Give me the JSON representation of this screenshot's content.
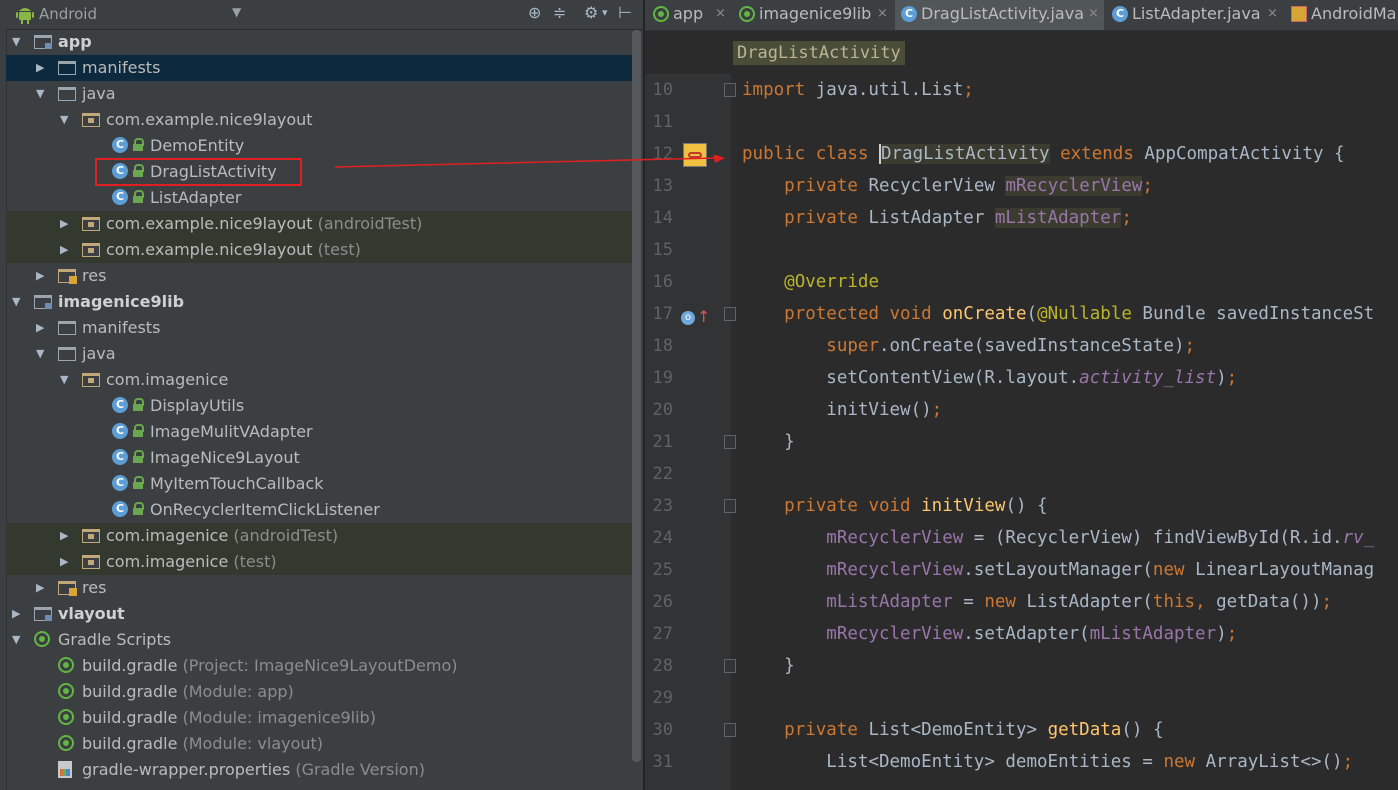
{
  "project_panel": {
    "view_selector": "Android",
    "tools": [
      "target-icon",
      "collapse-icon",
      "settings-icon",
      "pin-icon"
    ],
    "tree": [
      {
        "indent": 0,
        "arrow": "down",
        "icon": "module-folder-icon",
        "label": "app",
        "bold": true
      },
      {
        "indent": 1,
        "arrow": "right",
        "icon": "folder-icon",
        "label": "manifests",
        "selected": true
      },
      {
        "indent": 1,
        "arrow": "down",
        "icon": "folder-icon",
        "label": "java"
      },
      {
        "indent": 2,
        "arrow": "down",
        "icon": "package-icon",
        "label": "com.example.nice9layout"
      },
      {
        "indent": 3,
        "arrow": "",
        "icon": "class-icon",
        "label": "DemoEntity"
      },
      {
        "indent": 3,
        "arrow": "",
        "icon": "class-icon",
        "label": "DragListActivity"
      },
      {
        "indent": 3,
        "arrow": "",
        "icon": "class-icon",
        "label": "ListAdapter"
      },
      {
        "indent": 2,
        "arrow": "right",
        "icon": "package-icon",
        "label": "com.example.nice9layout",
        "suffix": " (androidTest)",
        "green": true
      },
      {
        "indent": 2,
        "arrow": "right",
        "icon": "package-icon",
        "label": "com.example.nice9layout",
        "suffix": " (test)",
        "green": true
      },
      {
        "indent": 1,
        "arrow": "right",
        "icon": "res-folder-icon",
        "label": "res"
      },
      {
        "indent": 0,
        "arrow": "down",
        "icon": "module-folder-icon",
        "label": "imagenice9lib",
        "bold": true
      },
      {
        "indent": 1,
        "arrow": "right",
        "icon": "folder-icon",
        "label": "manifests"
      },
      {
        "indent": 1,
        "arrow": "down",
        "icon": "folder-icon",
        "label": "java"
      },
      {
        "indent": 2,
        "arrow": "down",
        "icon": "package-icon",
        "label": "com.imagenice"
      },
      {
        "indent": 3,
        "arrow": "",
        "icon": "class-icon",
        "label": "DisplayUtils"
      },
      {
        "indent": 3,
        "arrow": "",
        "icon": "class-icon",
        "label": "ImageMulitVAdapter"
      },
      {
        "indent": 3,
        "arrow": "",
        "icon": "class-icon",
        "label": "ImageNice9Layout"
      },
      {
        "indent": 3,
        "arrow": "",
        "icon": "class-icon",
        "label": "MyItemTouchCallback"
      },
      {
        "indent": 3,
        "arrow": "",
        "icon": "class-icon",
        "label": "OnRecyclerItemClickListener"
      },
      {
        "indent": 2,
        "arrow": "right",
        "icon": "package-icon",
        "label": "com.imagenice",
        "suffix": " (androidTest)",
        "green": true
      },
      {
        "indent": 2,
        "arrow": "right",
        "icon": "package-icon",
        "label": "com.imagenice",
        "suffix": " (test)",
        "green": true
      },
      {
        "indent": 1,
        "arrow": "right",
        "icon": "res-folder-icon",
        "label": "res"
      },
      {
        "indent": 0,
        "arrow": "right",
        "icon": "module-folder-icon",
        "label": "vlayout",
        "bold": true
      },
      {
        "indent": 0,
        "arrow": "down",
        "icon": "gradle-icon",
        "label": "Gradle Scripts"
      },
      {
        "indent": 1,
        "arrow": "",
        "icon": "gradle-icon",
        "label": "build.gradle",
        "suffix": " (Project: ImageNice9LayoutDemo)"
      },
      {
        "indent": 1,
        "arrow": "",
        "icon": "gradle-icon",
        "label": "build.gradle",
        "suffix": " (Module: app)"
      },
      {
        "indent": 1,
        "arrow": "",
        "icon": "gradle-icon",
        "label": "build.gradle",
        "suffix": " (Module: imagenice9lib)"
      },
      {
        "indent": 1,
        "arrow": "",
        "icon": "gradle-icon",
        "label": "build.gradle",
        "suffix": " (Module: vlayout)"
      },
      {
        "indent": 1,
        "arrow": "",
        "icon": "properties-icon",
        "label": "gradle-wrapper.properties",
        "suffix": " (Gradle Version)"
      }
    ]
  },
  "editor": {
    "tabs": [
      {
        "label": "app",
        "icon": "module-icon",
        "active": false
      },
      {
        "label": "imagenice9lib",
        "icon": "module-icon",
        "active": false
      },
      {
        "label": "DragListActivity.java",
        "icon": "class-icon",
        "active": true
      },
      {
        "label": "ListAdapter.java",
        "icon": "class-icon",
        "active": false
      },
      {
        "label": "AndroidMa",
        "icon": "manifest-icon",
        "active": false
      }
    ],
    "close_glyph": "×",
    "breadcrumb": "DragListActivity",
    "lines": [
      {
        "n": "10",
        "html": "<span class='k'>import</span> java.util.List<span class='k'>;</span>"
      },
      {
        "n": "11",
        "html": ""
      },
      {
        "n": "12",
        "html": "<span class='k'>public class</span> <span class='cur hl'>DragListActivity</span> <span class='k'>extends</span> AppCompatActivity {"
      },
      {
        "n": "13",
        "html": "    <span class='k'>private</span> RecyclerView <span class='f hl'>mRecyclerView</span><span class='k'>;</span>"
      },
      {
        "n": "14",
        "html": "    <span class='k'>private</span> ListAdapter <span class='f hl'>mListAdapter</span><span class='k'>;</span>"
      },
      {
        "n": "15",
        "html": ""
      },
      {
        "n": "16",
        "html": "    <span class='an'>@Override</span>"
      },
      {
        "n": "17",
        "html": "    <span class='k'>protected void</span> <span class='m'>onCreate</span>(<span class='an'>@Nullable</span> Bundle savedInstanceSt"
      },
      {
        "n": "18",
        "html": "        <span class='k'>super</span>.onCreate(savedInstanceState)<span class='k'>;</span>"
      },
      {
        "n": "19",
        "html": "        setContentView(R.layout.<span class='fi'>activity_list</span>)<span class='k'>;</span>"
      },
      {
        "n": "20",
        "html": "        initView()<span class='k'>;</span>"
      },
      {
        "n": "21",
        "html": "    }"
      },
      {
        "n": "22",
        "html": ""
      },
      {
        "n": "23",
        "html": "    <span class='k'>private void</span> <span class='m'>initView</span>() {"
      },
      {
        "n": "24",
        "html": "        <span class='f'>mRecyclerView</span> = (RecyclerView) findViewById(R.id.<span class='fi'>rv_</span>"
      },
      {
        "n": "25",
        "html": "        <span class='f'>mRecyclerView</span>.setLayoutManager(<span class='k'>new</span> LinearLayoutManag"
      },
      {
        "n": "26",
        "html": "        <span class='f'>mListAdapter</span> = <span class='k'>new</span> ListAdapter(<span class='k'>this,</span> getData())<span class='k'>;</span>"
      },
      {
        "n": "27",
        "html": "        <span class='f'>mRecyclerView</span>.setAdapter(<span class='f'>mListAdapter</span>)<span class='k'>;</span>"
      },
      {
        "n": "28",
        "html": "    }"
      },
      {
        "n": "29",
        "html": ""
      },
      {
        "n": "30",
        "html": "    <span class='k'>private</span> List&lt;DemoEntity&gt; <span class='m'>getData</span>() {"
      },
      {
        "n": "31",
        "html": "        List&lt;DemoEntity&gt; demoEntities = <span class='k'>new</span> ArrayList&lt;&gt;()<span class='k'>;</span>"
      }
    ]
  },
  "colors": {
    "accent_red": "#e02020",
    "keyword": "#cc7832",
    "field": "#9876aa",
    "method": "#ffc66d",
    "annotation": "#bbb529"
  }
}
